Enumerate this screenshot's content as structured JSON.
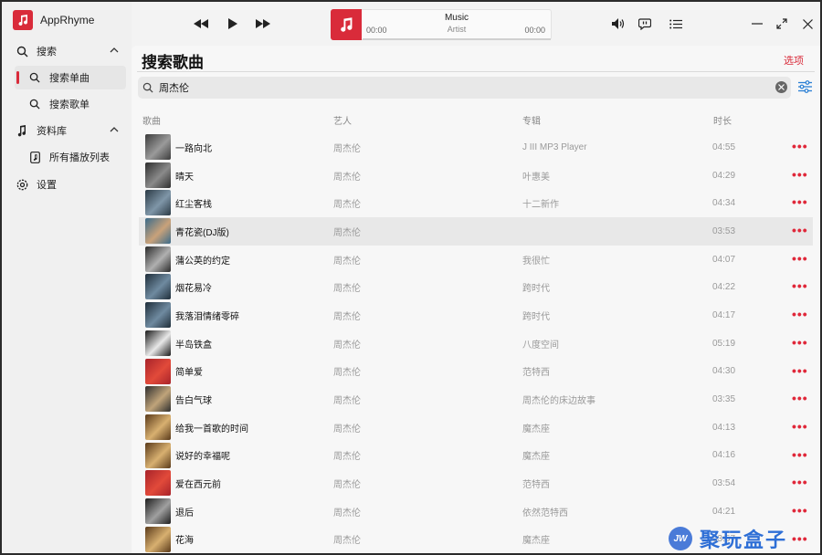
{
  "app": {
    "title": "AppRhyme"
  },
  "sidebar": {
    "search_label": "搜索",
    "search_single_label": "搜索单曲",
    "search_playlist_label": "搜索歌单",
    "library_label": "资料库",
    "all_playlists_label": "所有播放列表",
    "settings_label": "设置"
  },
  "player": {
    "title": "Music",
    "artist": "Artist",
    "time_current": "00:00",
    "time_total": "00:00",
    "progress": 0
  },
  "page": {
    "title": "搜索歌曲",
    "options_label": "选项",
    "search_value": "周杰伦"
  },
  "table": {
    "headers": {
      "song": "歌曲",
      "artist": "艺人",
      "album": "专辑",
      "duration": "时长"
    },
    "rows": [
      {
        "title": "一路向北",
        "artist": "周杰伦",
        "album": "J III MP3 Player",
        "duration": "04:55",
        "cover": [
          "#3c3c3c",
          "#9a9a9a"
        ]
      },
      {
        "title": "晴天",
        "artist": "周杰伦",
        "album": "叶惠美",
        "duration": "04:29",
        "cover": [
          "#2e2e2e",
          "#8a8a8a"
        ]
      },
      {
        "title": "红尘客栈",
        "artist": "周杰伦",
        "album": "十二新作",
        "duration": "04:34",
        "cover": [
          "#2b3a45",
          "#7f96a8"
        ]
      },
      {
        "title": "青花瓷(DJ版)",
        "artist": "周杰伦",
        "album": "",
        "duration": "03:53",
        "cover": [
          "#3a6b8a",
          "#c9a27a"
        ]
      },
      {
        "title": "蒲公英的约定",
        "artist": "周杰伦",
        "album": "我很忙",
        "duration": "04:07",
        "cover": [
          "#2a2a2a",
          "#b0b0b0"
        ]
      },
      {
        "title": "烟花易冷",
        "artist": "周杰伦",
        "album": "跨时代",
        "duration": "04:22",
        "cover": [
          "#1f2e3a",
          "#6f8aa0"
        ]
      },
      {
        "title": "我落泪情绪零碎",
        "artist": "周杰伦",
        "album": "跨时代",
        "duration": "04:17",
        "cover": [
          "#1f2e3a",
          "#6f8aa0"
        ]
      },
      {
        "title": "半岛铁盒",
        "artist": "周杰伦",
        "album": "八度空间",
        "duration": "05:19",
        "cover": [
          "#1a1a1a",
          "#e8e8e8"
        ]
      },
      {
        "title": "简单爱",
        "artist": "周杰伦",
        "album": "范特西",
        "duration": "04:30",
        "cover": [
          "#a8232a",
          "#e24a3a"
        ]
      },
      {
        "title": "告白气球",
        "artist": "周杰伦",
        "album": "周杰伦的床边故事",
        "duration": "03:35",
        "cover": [
          "#2e2e2e",
          "#c0a47a"
        ]
      },
      {
        "title": "给我一首歌的时间",
        "artist": "周杰伦",
        "album": "魔杰座",
        "duration": "04:13",
        "cover": [
          "#5a3a1a",
          "#d8b070"
        ]
      },
      {
        "title": "说好的幸福呢",
        "artist": "周杰伦",
        "album": "魔杰座",
        "duration": "04:16",
        "cover": [
          "#5a3a1a",
          "#d8b070"
        ]
      },
      {
        "title": "爱在西元前",
        "artist": "周杰伦",
        "album": "范特西",
        "duration": "03:54",
        "cover": [
          "#a8232a",
          "#e24a3a"
        ]
      },
      {
        "title": "退后",
        "artist": "周杰伦",
        "album": "依然范特西",
        "duration": "04:21",
        "cover": [
          "#1e1e1e",
          "#a0a0a0"
        ]
      },
      {
        "title": "花海",
        "artist": "周杰伦",
        "album": "魔杰座",
        "duration": "03:57",
        "cover": [
          "#5a3a1a",
          "#d8b070"
        ]
      }
    ],
    "more_label": "•••"
  },
  "watermark": {
    "badge": "JW",
    "text": "聚玩盒子"
  },
  "colors": {
    "accent": "#d92b3a",
    "more": "#e0283a"
  },
  "icons": [
    "music-note-icon",
    "search-icon",
    "chevron-up-icon",
    "library-icon",
    "playlist-icon",
    "settings-icon",
    "previous-icon",
    "play-icon",
    "next-icon",
    "volume-icon",
    "lyrics-icon",
    "queue-icon",
    "minimize-icon",
    "maximize-icon",
    "close-icon",
    "clear-icon",
    "filter-icon"
  ]
}
